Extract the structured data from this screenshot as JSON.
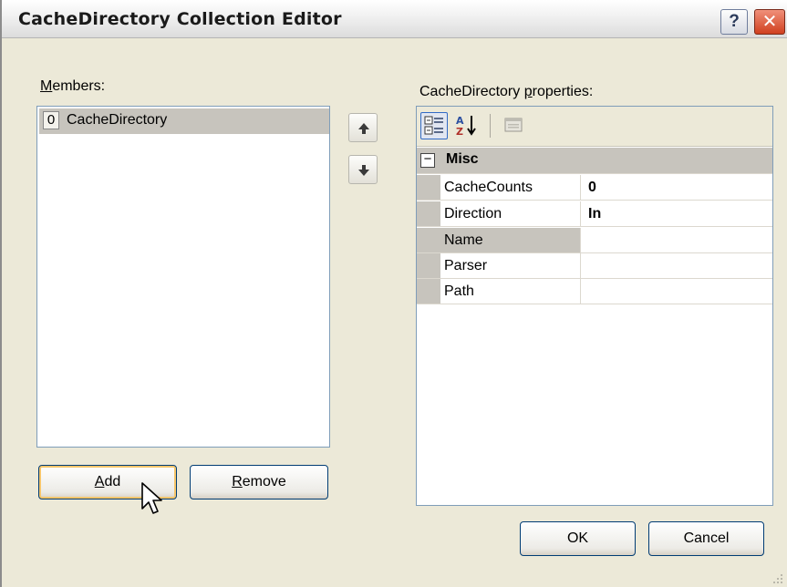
{
  "window": {
    "title": "CacheDirectory Collection Editor"
  },
  "titlebar": {
    "help_glyph": "?",
    "close_glyph": "✕"
  },
  "members": {
    "label_accel": "M",
    "label_rest": "embers:",
    "items": [
      {
        "index": "0",
        "name": "CacheDirectory"
      }
    ]
  },
  "properties": {
    "label_pre": "CacheDirectory ",
    "label_accel": "p",
    "label_post": "roperties:",
    "category": {
      "toggle": "−",
      "name": "Misc"
    },
    "rows": [
      {
        "name": "CacheCounts",
        "value": "0"
      },
      {
        "name": "Direction",
        "value": "In"
      },
      {
        "name": "Name",
        "value": ""
      },
      {
        "name": "Parser",
        "value": ""
      },
      {
        "name": "Path",
        "value": ""
      }
    ],
    "selected_row": "Name"
  },
  "buttons": {
    "add_accel": "A",
    "add_rest": "dd",
    "remove_accel": "R",
    "remove_rest": "emove",
    "ok": "OK",
    "cancel": "Cancel"
  },
  "icons": {
    "move_up": "arrow-up-icon",
    "move_down": "arrow-down-icon",
    "categorized": "categorized-icon",
    "alphabetical": "sort-alphabetical-icon",
    "property_pages": "property-pages-icon",
    "cursor": "mouse-pointer-icon"
  },
  "colors": {
    "selection_gray": "#c7c4bd",
    "dialog_bg": "#ece9d8",
    "focus_ring": "#f5c56a",
    "border_blue": "#003c74"
  }
}
